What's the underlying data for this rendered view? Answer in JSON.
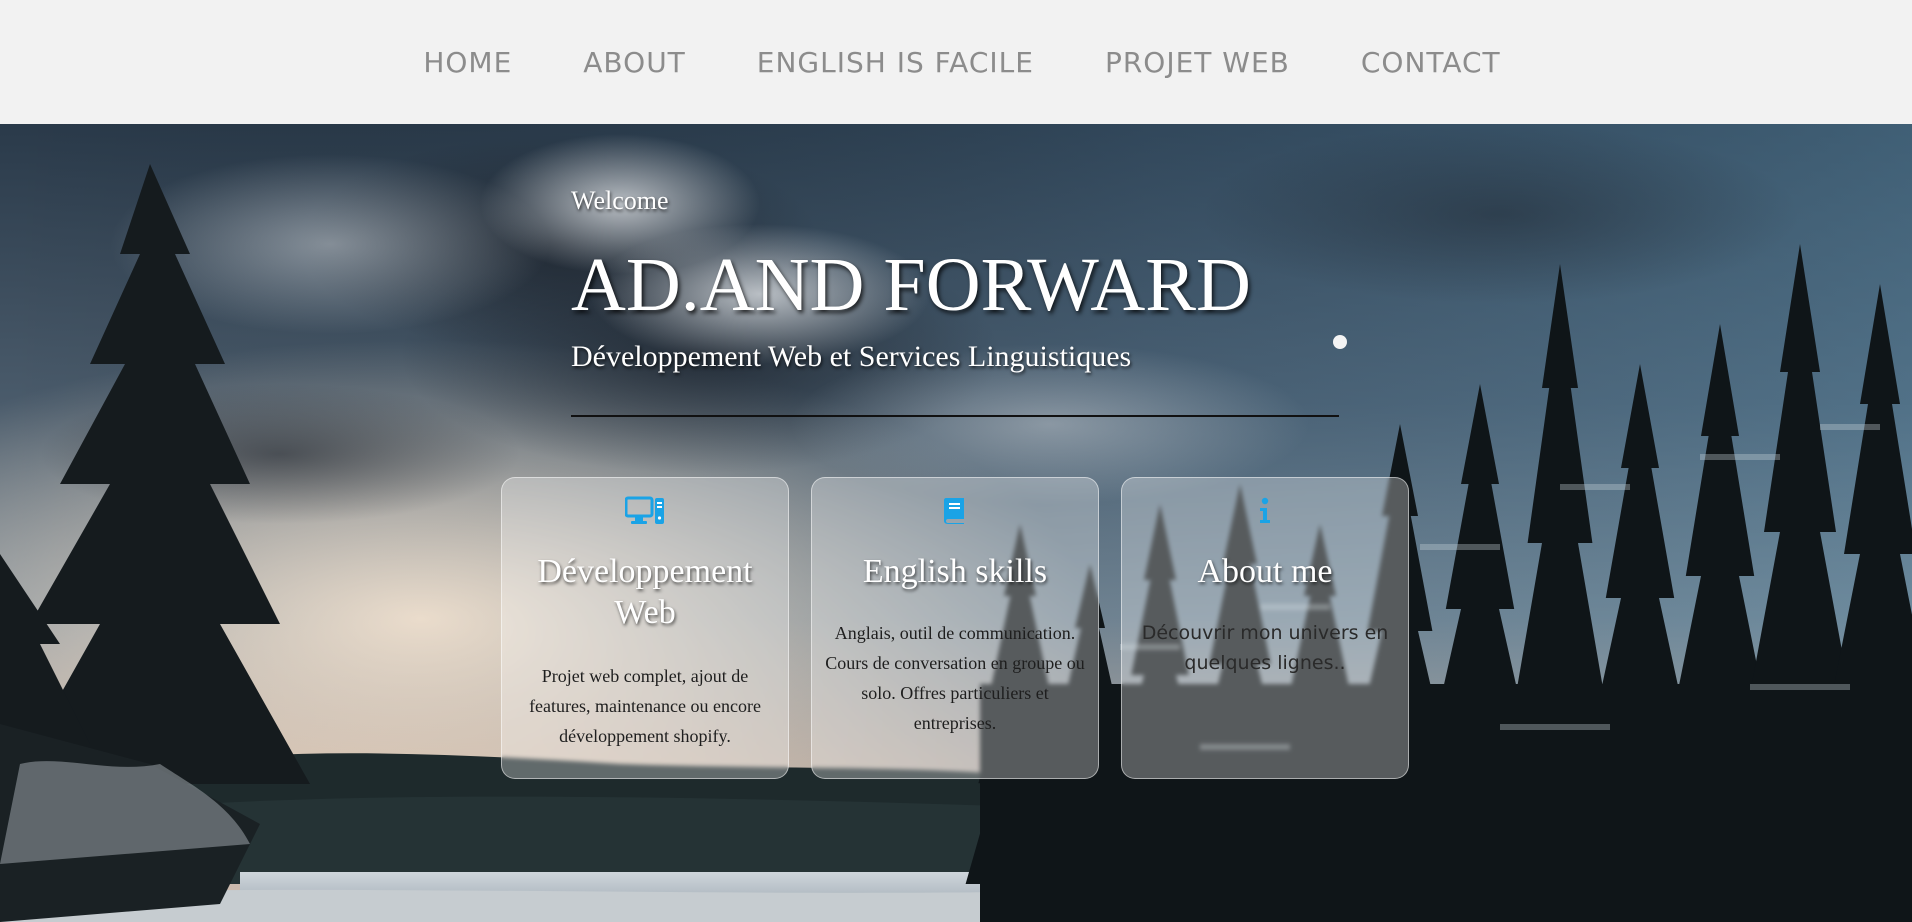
{
  "nav": {
    "items": [
      {
        "label": "HOME"
      },
      {
        "label": "ABOUT"
      },
      {
        "label": "ENGLISH IS FACILE"
      },
      {
        "label": "PROJET WEB"
      },
      {
        "label": "CONTACT"
      }
    ]
  },
  "hero": {
    "welcome": "Welcome",
    "title": "AD.AND FORWARD",
    "subtitle": "Développement Web et Services Linguistiques",
    "background_description_icon": "snowy-forest-lake-landscape"
  },
  "cards": [
    {
      "icon": "desktop-computer-icon",
      "title": "Développement Web",
      "text": "Projet web complet, ajout de features, maintenance ou encore développement shopify."
    },
    {
      "icon": "book-icon",
      "title": "English skills",
      "text": "Anglais, outil de communication. Cours de conversation en groupe ou solo. Offres particuliers et entreprises."
    },
    {
      "icon": "info-icon",
      "title": "About me",
      "text": "Découvrir mon univers en quelques lignes.."
    }
  ],
  "colors": {
    "nav_bg": "#f2f2f2",
    "nav_text": "#8c8c8c",
    "icon_accent": "#1aa3e6"
  }
}
